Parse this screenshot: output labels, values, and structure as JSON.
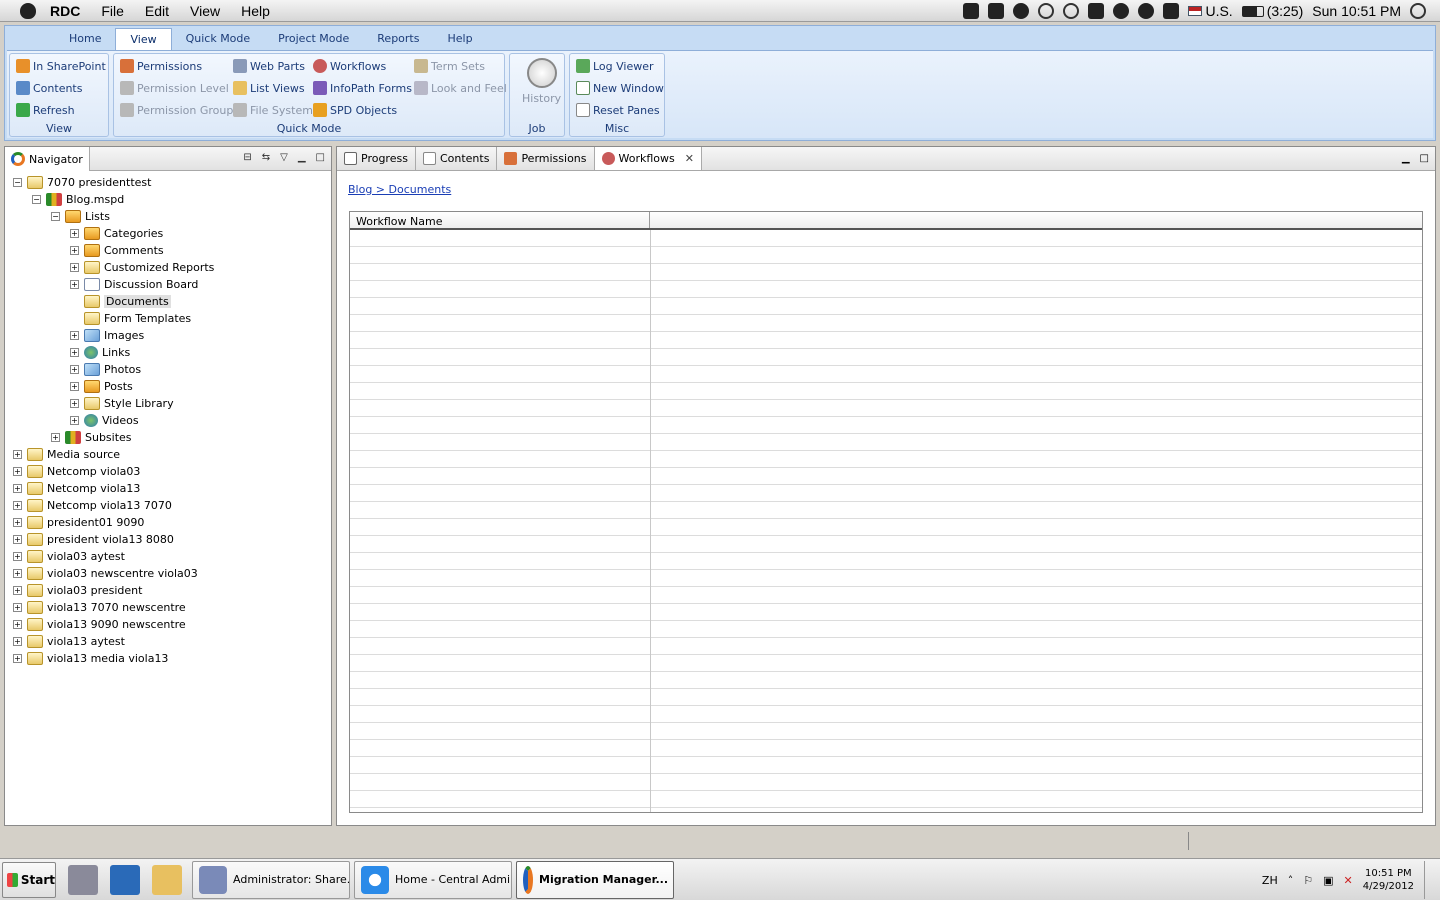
{
  "menubar": {
    "app": "RDC",
    "items": [
      "File",
      "Edit",
      "View",
      "Help"
    ],
    "locale": "U.S.",
    "battery": "(3:25)",
    "datetime": "Sun 10:51 PM"
  },
  "ribbon": {
    "tabs": [
      "Home",
      "View",
      "Quick Mode",
      "Project Mode",
      "Reports",
      "Help"
    ],
    "active_tab": "View",
    "view_group": {
      "title": "View",
      "items": [
        "In SharePoint",
        "Contents",
        "Refresh"
      ]
    },
    "quick_group": {
      "title": "Quick Mode",
      "col1": [
        "Permissions",
        "Permission Level",
        "Permission Groups"
      ],
      "col2": [
        "Web Parts",
        "List Views",
        "File System"
      ],
      "col3": [
        "Workflows",
        "InfoPath Forms",
        "SPD Objects"
      ],
      "col4": [
        "Term Sets",
        "Look and Feel"
      ]
    },
    "job_group": {
      "title": "Job",
      "history": "History"
    },
    "misc_group": {
      "title": "Misc",
      "items": [
        "Log Viewer",
        "New Window",
        "Reset Panes"
      ]
    }
  },
  "navigator": {
    "title": "Navigator",
    "tree": [
      {
        "label": "7070 presidenttest",
        "expanded": true
      },
      {
        "label": "Blog.mspd",
        "expanded": true
      },
      {
        "label": "Lists",
        "expanded": true
      },
      {
        "label": "Categories"
      },
      {
        "label": "Comments"
      },
      {
        "label": "Customized Reports"
      },
      {
        "label": "Discussion Board"
      },
      {
        "label": "Documents",
        "selected": true
      },
      {
        "label": "Form Templates"
      },
      {
        "label": "Images"
      },
      {
        "label": "Links"
      },
      {
        "label": "Photos"
      },
      {
        "label": "Posts"
      },
      {
        "label": "Style Library"
      },
      {
        "label": "Videos"
      },
      {
        "label": "Subsites"
      },
      {
        "label": "Media source"
      },
      {
        "label": "Netcomp viola03"
      },
      {
        "label": "Netcomp viola13"
      },
      {
        "label": "Netcomp viola13 7070"
      },
      {
        "label": "president01 9090"
      },
      {
        "label": "president viola13 8080"
      },
      {
        "label": "viola03 aytest"
      },
      {
        "label": "viola03 newscentre viola03"
      },
      {
        "label": "viola03 president"
      },
      {
        "label": "viola13 7070 newscentre"
      },
      {
        "label": "viola13 9090 newscentre"
      },
      {
        "label": "viola13 aytest"
      },
      {
        "label": "viola13 media viola13"
      }
    ]
  },
  "editor": {
    "tabs": [
      "Progress",
      "Contents",
      "Permissions",
      "Workflows"
    ],
    "active_tab": "Workflows",
    "breadcrumb": "Blog > Documents",
    "table": {
      "columns": [
        "Workflow Name",
        ""
      ],
      "rows": []
    }
  },
  "taskbar": {
    "start": "Start",
    "windows": [
      "Administrator: Share...",
      "Home - Central Admin...",
      "Migration Manager..."
    ],
    "active_window": "Migration Manager...",
    "lang": "ZH",
    "time": "10:51 PM",
    "date": "4/29/2012"
  },
  "colors": {
    "ribbon_bg": "#c6dcf4",
    "link": "#1a3eb5",
    "ribbon_text": "#1c3c78"
  }
}
